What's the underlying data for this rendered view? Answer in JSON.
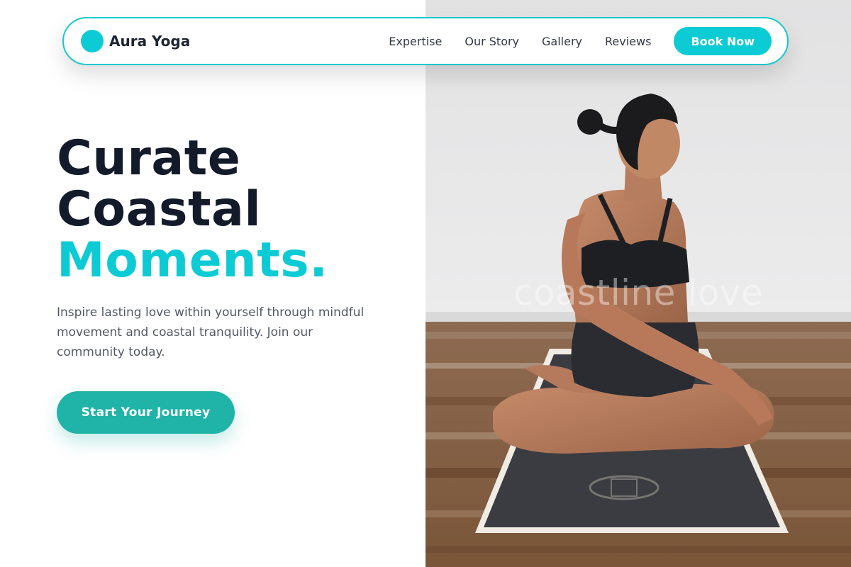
{
  "brand": {
    "name": "Aura Yoga",
    "accent_color": "#0ccbd4",
    "cta_color": "#20b3a7",
    "heading_color": "#131a2a"
  },
  "nav": {
    "links": [
      "Expertise",
      "Our Story",
      "Gallery",
      "Reviews"
    ],
    "book_label": "Book Now"
  },
  "hero": {
    "headline_line1": "Curate",
    "headline_line2": "Coastal",
    "headline_line3": "Moments.",
    "subtext": "Inspire lasting love within yourself through mindful movement and coastal tranquility. Join our community today.",
    "cta_label": "Start Your Journey"
  },
  "photo": {
    "watermark": "coastline love",
    "subject": "woman seated cross-legged on yoga mat in a twist pose"
  },
  "icons": {
    "logo_mark": "teal-circle-logo-icon"
  }
}
